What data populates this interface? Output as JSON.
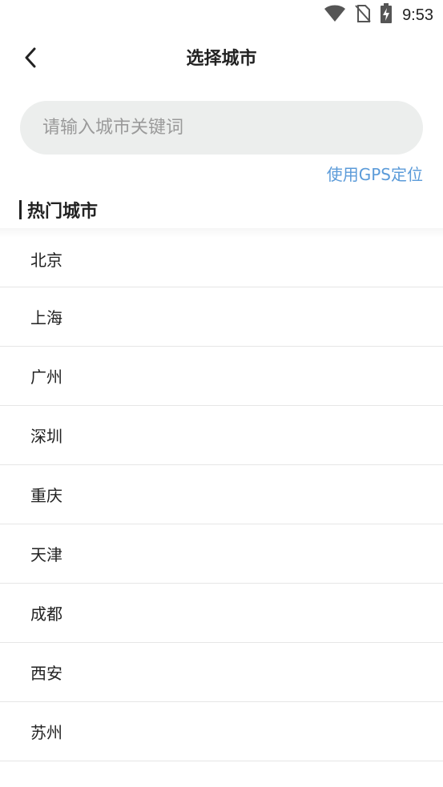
{
  "status_bar": {
    "time": "9:53",
    "icons": [
      "wifi-icon",
      "no-sim-icon",
      "battery-charging-icon"
    ]
  },
  "header": {
    "title": "选择城市",
    "back_icon": "chevron-left-icon"
  },
  "search": {
    "placeholder": "请输入城市关键词",
    "value": ""
  },
  "gps": {
    "label": "使用GPS定位",
    "color": "#5b9bd9"
  },
  "section": {
    "title": "热门城市"
  },
  "cities": [
    "北京",
    "上海",
    "广州",
    "深圳",
    "重庆",
    "天津",
    "成都",
    "西安",
    "苏州"
  ],
  "colors": {
    "search_bg": "#eceeed",
    "divider": "#e6e6e6",
    "text": "#222222",
    "placeholder": "#9a9a9a"
  }
}
